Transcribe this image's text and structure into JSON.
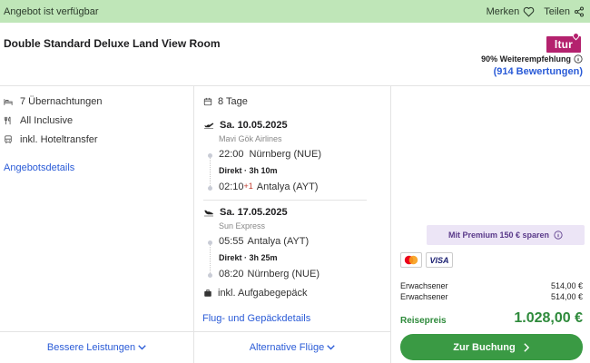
{
  "topbar": {
    "availability": "Angebot ist verfügbar",
    "save_label": "Merken",
    "share_label": "Teilen"
  },
  "header": {
    "room_title": "Double Standard Deluxe Land View Room",
    "brand": "ltur",
    "recommendation": "90% Weiterempfehlung",
    "reviews": "(914 Bewertungen)"
  },
  "features": {
    "items": [
      {
        "icon": "bed-icon",
        "label": "7 Übernachtungen"
      },
      {
        "icon": "cutlery-icon",
        "label": "All Inclusive"
      },
      {
        "icon": "bus-icon",
        "label": "inkl. Hoteltransfer"
      }
    ],
    "details_link": "Angebotsdetails"
  },
  "trip": {
    "duration": "8 Tage",
    "outbound": {
      "date": "Sa. 10.05.2025",
      "airline": "Mavi Gök Airlines",
      "depart_time": "22:00",
      "depart_place": "Nürnberg (NUE)",
      "direct": "Direkt · 3h 10m",
      "arrive_time": "02:10",
      "arrive_offset": "+1",
      "arrive_place": "Antalya (AYT)"
    },
    "inbound": {
      "date": "Sa. 17.05.2025",
      "airline": "Sun Express",
      "depart_time": "05:55",
      "depart_place": "Antalya (AYT)",
      "direct": "Direkt · 3h 25m",
      "arrive_time": "08:20",
      "arrive_place": "Nürnberg (NUE)"
    },
    "luggage": "inkl. Aufgabegepäck",
    "details_link": "Flug- und Gepäckdetails"
  },
  "pricing": {
    "premium": "Mit Premium 150 € sparen",
    "card_visa": "VISA",
    "passengers": [
      {
        "label": "Erwachsener",
        "price": "514,00 €"
      },
      {
        "label": "Erwachsener",
        "price": "514,00 €"
      }
    ],
    "total_label": "Reisepreis",
    "total": "1.028,00 €",
    "book_label": "Zur Buchung"
  },
  "bottom": {
    "better_services": "Bessere Leistungen",
    "alternative_flights": "Alternative Flüge"
  },
  "colors": {
    "topbar_bg": "#bfe6b8",
    "link": "#2a5bd7",
    "price_green": "#2e8a3b",
    "book_button": "#3a9a44",
    "brand": "#b4226e",
    "premium_bg": "#ece5f6"
  }
}
